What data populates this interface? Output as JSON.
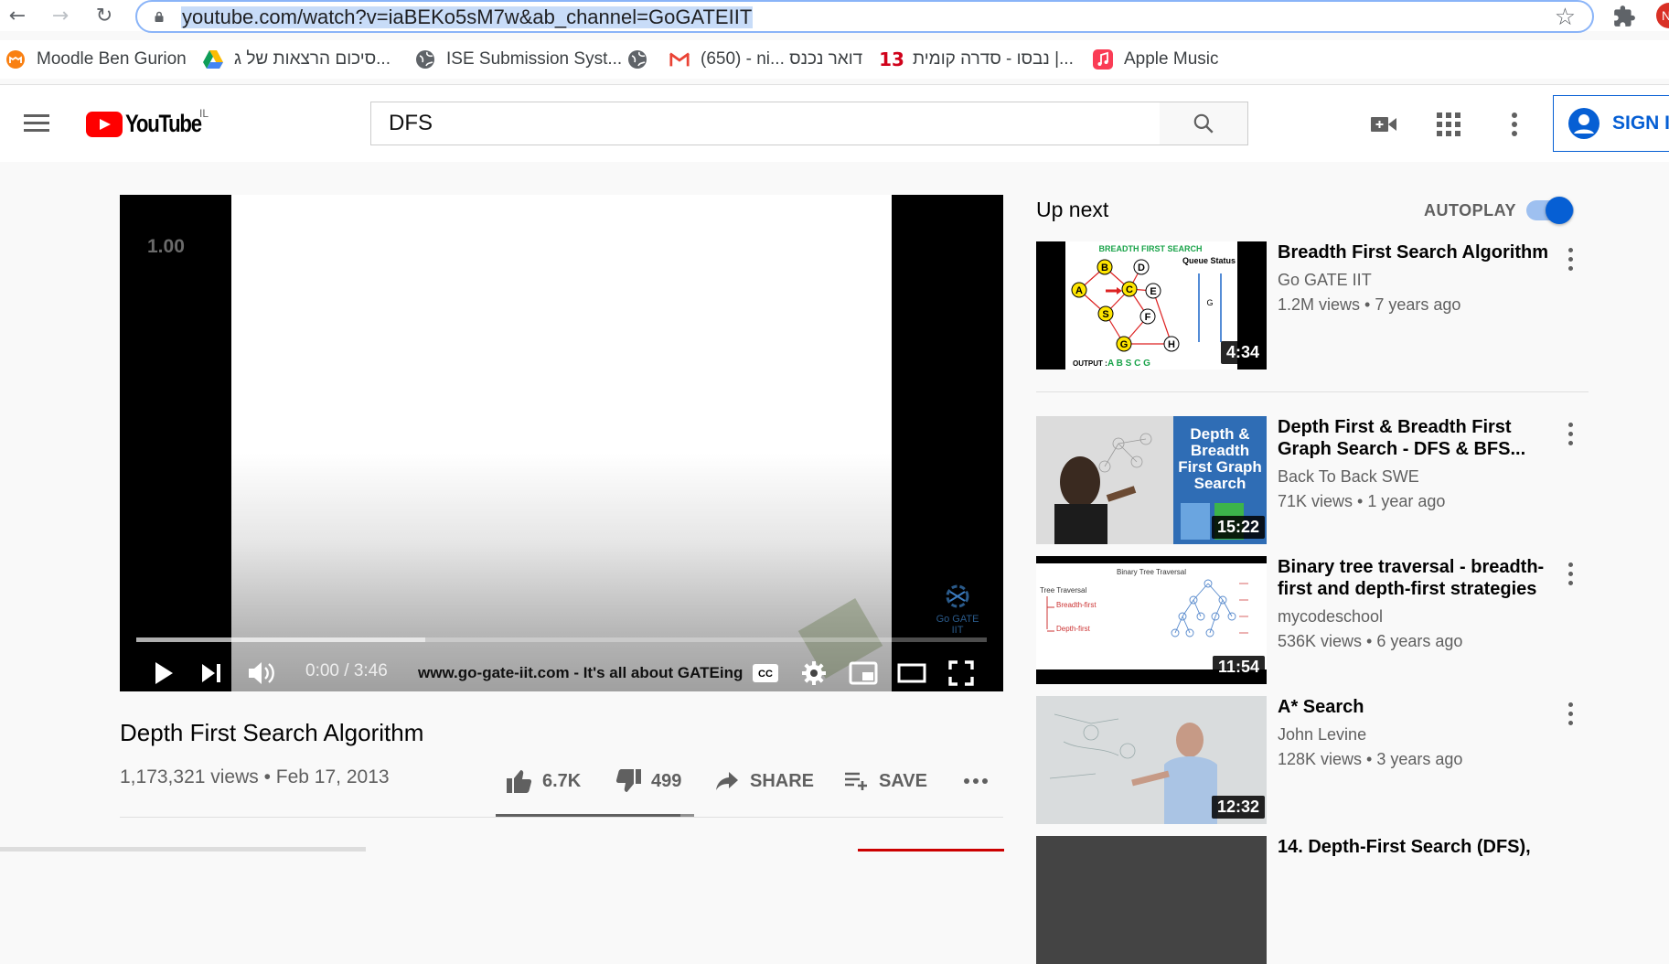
{
  "browser": {
    "url": "youtube.com/watch?v=iaBEKo5sM7w&ab_channel=GoGATEIIT",
    "profile_initial": "N",
    "bookmarks": [
      {
        "label": "Moodle Ben Gurion",
        "icon": "moodle-icon"
      },
      {
        "label": "סיכום הרצאות של ג...",
        "icon": "google-drive-icon"
      },
      {
        "label": "ISE Submission Syst...",
        "icon": "globe-icon"
      },
      {
        "label": "",
        "icon": "globe-icon"
      },
      {
        "label": "(650) - ni... דואר נכנס",
        "icon": "gmail-icon"
      },
      {
        "label": "נבסו - סדרה קומית |...",
        "icon": "channel-13-icon"
      },
      {
        "label": "Apple Music",
        "icon": "apple-music-icon"
      }
    ]
  },
  "header": {
    "logo_text": "YouTube",
    "country_code": "IL",
    "search_value": "DFS",
    "signin_label": "SIGN IN"
  },
  "player": {
    "speed_label": "1.00",
    "current_time": "0:00",
    "duration": "3:46",
    "time_display": "0:00 / 3:46",
    "caption_text": "www.go-gate-iit.com - It's all about GATEing",
    "watermark_text": "Go GATE IIT",
    "buffered_fraction": 0.34
  },
  "video": {
    "title": "Depth First Search Algorithm",
    "meta": "1,173,321 views • Feb 17, 2013",
    "likes": "6.7K",
    "dislikes": "499",
    "share_label": "SHARE",
    "save_label": "SAVE",
    "like_ratio": 0.93
  },
  "sidebar": {
    "up_next_label": "Up next",
    "autoplay_label": "AUTOPLAY",
    "autoplay_on": true,
    "recommendations": [
      {
        "title": "Breadth First Search Algorithm",
        "channel": "Go GATE IIT",
        "views": "1.2M views • 7 years ago",
        "duration": "4:34"
      },
      {
        "title": "Depth First & Breadth First Graph Search - DFS & BFS...",
        "channel": "Back To Back SWE",
        "views": "71K views • 1 year ago",
        "duration": "15:22"
      },
      {
        "title": "Binary tree traversal - breadth-first and depth-first strategies",
        "channel": "mycodeschool",
        "views": "536K views • 6 years ago",
        "duration": "11:54"
      },
      {
        "title": "A* Search",
        "channel": "John Levine",
        "views": "128K views • 3 years ago",
        "duration": "12:32"
      },
      {
        "title": "14. Depth-First Search (DFS),",
        "channel": "",
        "views": "",
        "duration": ""
      }
    ],
    "thumb1": {
      "heading": "BREADTH FIRST SEARCH",
      "queue_label": "Queue Status",
      "queue_value": "G",
      "output_label": "OUTPUT :",
      "output_value": "A B S C G",
      "nodes": [
        "A",
        "B",
        "C",
        "D",
        "E",
        "F",
        "G",
        "H",
        "S"
      ]
    },
    "thumb2": {
      "line1": "Depth &",
      "line2": "Breadth",
      "line3": "First Graph",
      "line4": "Search"
    },
    "thumb3": {
      "heading": "Binary Tree Traversal",
      "line1": "Tree Traversal",
      "line2": "Breadth-first",
      "line3": "Depth-first"
    }
  },
  "colors": {
    "youtube_red": "#ff0000",
    "link_blue": "#065fd4",
    "text_secondary": "#606060"
  }
}
